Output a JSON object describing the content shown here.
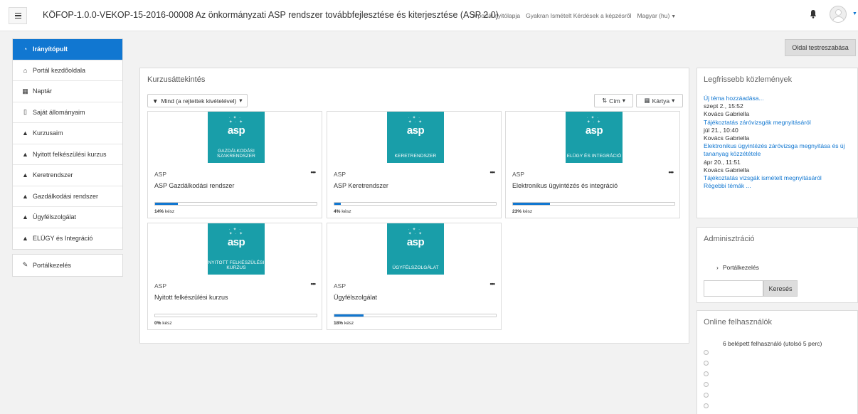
{
  "navbar": {
    "menu_toggle_label": "≡",
    "site_title": "KÖFOP-1.0.0-VEKOP-15-2016-00008 Az önkormányzati ASP rendszer továbbfejlesztése és kiterjesztése (ASP 2.0)",
    "links": [
      "A portál nyitólapja",
      "Gyakran Ismételt Kérdések a képzésről",
      "Magyar (hu)"
    ],
    "lang_caret": "▼",
    "avatar_caret": "▼"
  },
  "sidebar": {
    "items": [
      {
        "label": "Irányítópult",
        "icon": "dashboard-icon",
        "active": true
      },
      {
        "label": "Portál kezdőoldala",
        "icon": "home-icon"
      },
      {
        "label": "Naptár",
        "icon": "calendar-icon"
      },
      {
        "label": "Saját állományaim",
        "icon": "file-icon"
      },
      {
        "label": "Kurzusaim",
        "icon": "graduation-cap-icon"
      },
      {
        "label": "Nyitott felkészülési kurzus",
        "icon": "graduation-cap-icon"
      },
      {
        "label": "Keretrendszer",
        "icon": "graduation-cap-icon"
      },
      {
        "label": "Gazdálkodási rendszer",
        "icon": "graduation-cap-icon"
      },
      {
        "label": "Ügyfélszolgálat",
        "icon": "graduation-cap-icon"
      },
      {
        "label": "ELÜGY és Integráció",
        "icon": "graduation-cap-icon"
      }
    ],
    "admin_item": {
      "label": "Portálkezelés",
      "icon": "wrench-icon"
    }
  },
  "main": {
    "customize_button": "Oldal testreszabása",
    "overview_title": "Kurzusáttekintés",
    "filter_label": "Mind (a rejtettek kivételével)",
    "sort_label": "Cím",
    "view_label": "Kártya",
    "courses": [
      {
        "image_text": "GAZDÁLKODÁSI SZAKRENDSZER",
        "category": "ASP",
        "title": "ASP Gazdálkodási rendszer",
        "progress": 14,
        "progress_text": "14%",
        "progress_suffix": " kész"
      },
      {
        "image_text": "KERETRENDSZER",
        "category": "ASP",
        "title": "ASP Keretrendszer",
        "progress": 4,
        "progress_text": "4%",
        "progress_suffix": " kész"
      },
      {
        "image_text": "ELÜGY ÉS INTEGRÁCIÓ",
        "category": "ASP",
        "title": "Elektronikus ügyintézés és integráció",
        "progress": 23,
        "progress_text": "23%",
        "progress_suffix": " kész"
      },
      {
        "image_text": "NYITOTT FELKÉSZÜLÉSI KURZUS",
        "category": "ASP",
        "title": "Nyitott felkészülési kurzus",
        "progress": 0,
        "progress_text": "0%",
        "progress_suffix": " kész"
      },
      {
        "image_text": "ÜGYFÉLSZOLGÁLAT",
        "category": "ASP",
        "title": "Ügyfélszolgálat",
        "progress": 18,
        "progress_text": "18%",
        "progress_suffix": " kész"
      }
    ],
    "logo_text": "asp",
    "more_label": "•••"
  },
  "news": {
    "title": "Legfrissebb közlemények",
    "add_topic": "Új téma hozzáadása...",
    "items": [
      {
        "date": "szept 2., 15:52",
        "author": "Kovács Gabriella",
        "title": "Tájékoztatás záróvizsgák megnyitásáról"
      },
      {
        "date": "júl 21., 10:40",
        "author": "Kovács Gabriella",
        "title": "Elektronikus ügyintézés záróvizsga megnyitása és új tananyag közzététele"
      },
      {
        "date": "ápr 20., 11:51",
        "author": "Kovács Gabriella",
        "title": "Tájékoztatás vizsgák ismételt megnyitásáról"
      }
    ],
    "older": "Régebbi témák ..."
  },
  "admin": {
    "title": "Adminisztráció",
    "item": "Portálkezelés",
    "search_placeholder": "",
    "search_button": "Keresés"
  },
  "online": {
    "title": "Online felhasználók",
    "text": "6 belépett felhasználó (utolsó 5 perc)",
    "user_count": 6
  }
}
